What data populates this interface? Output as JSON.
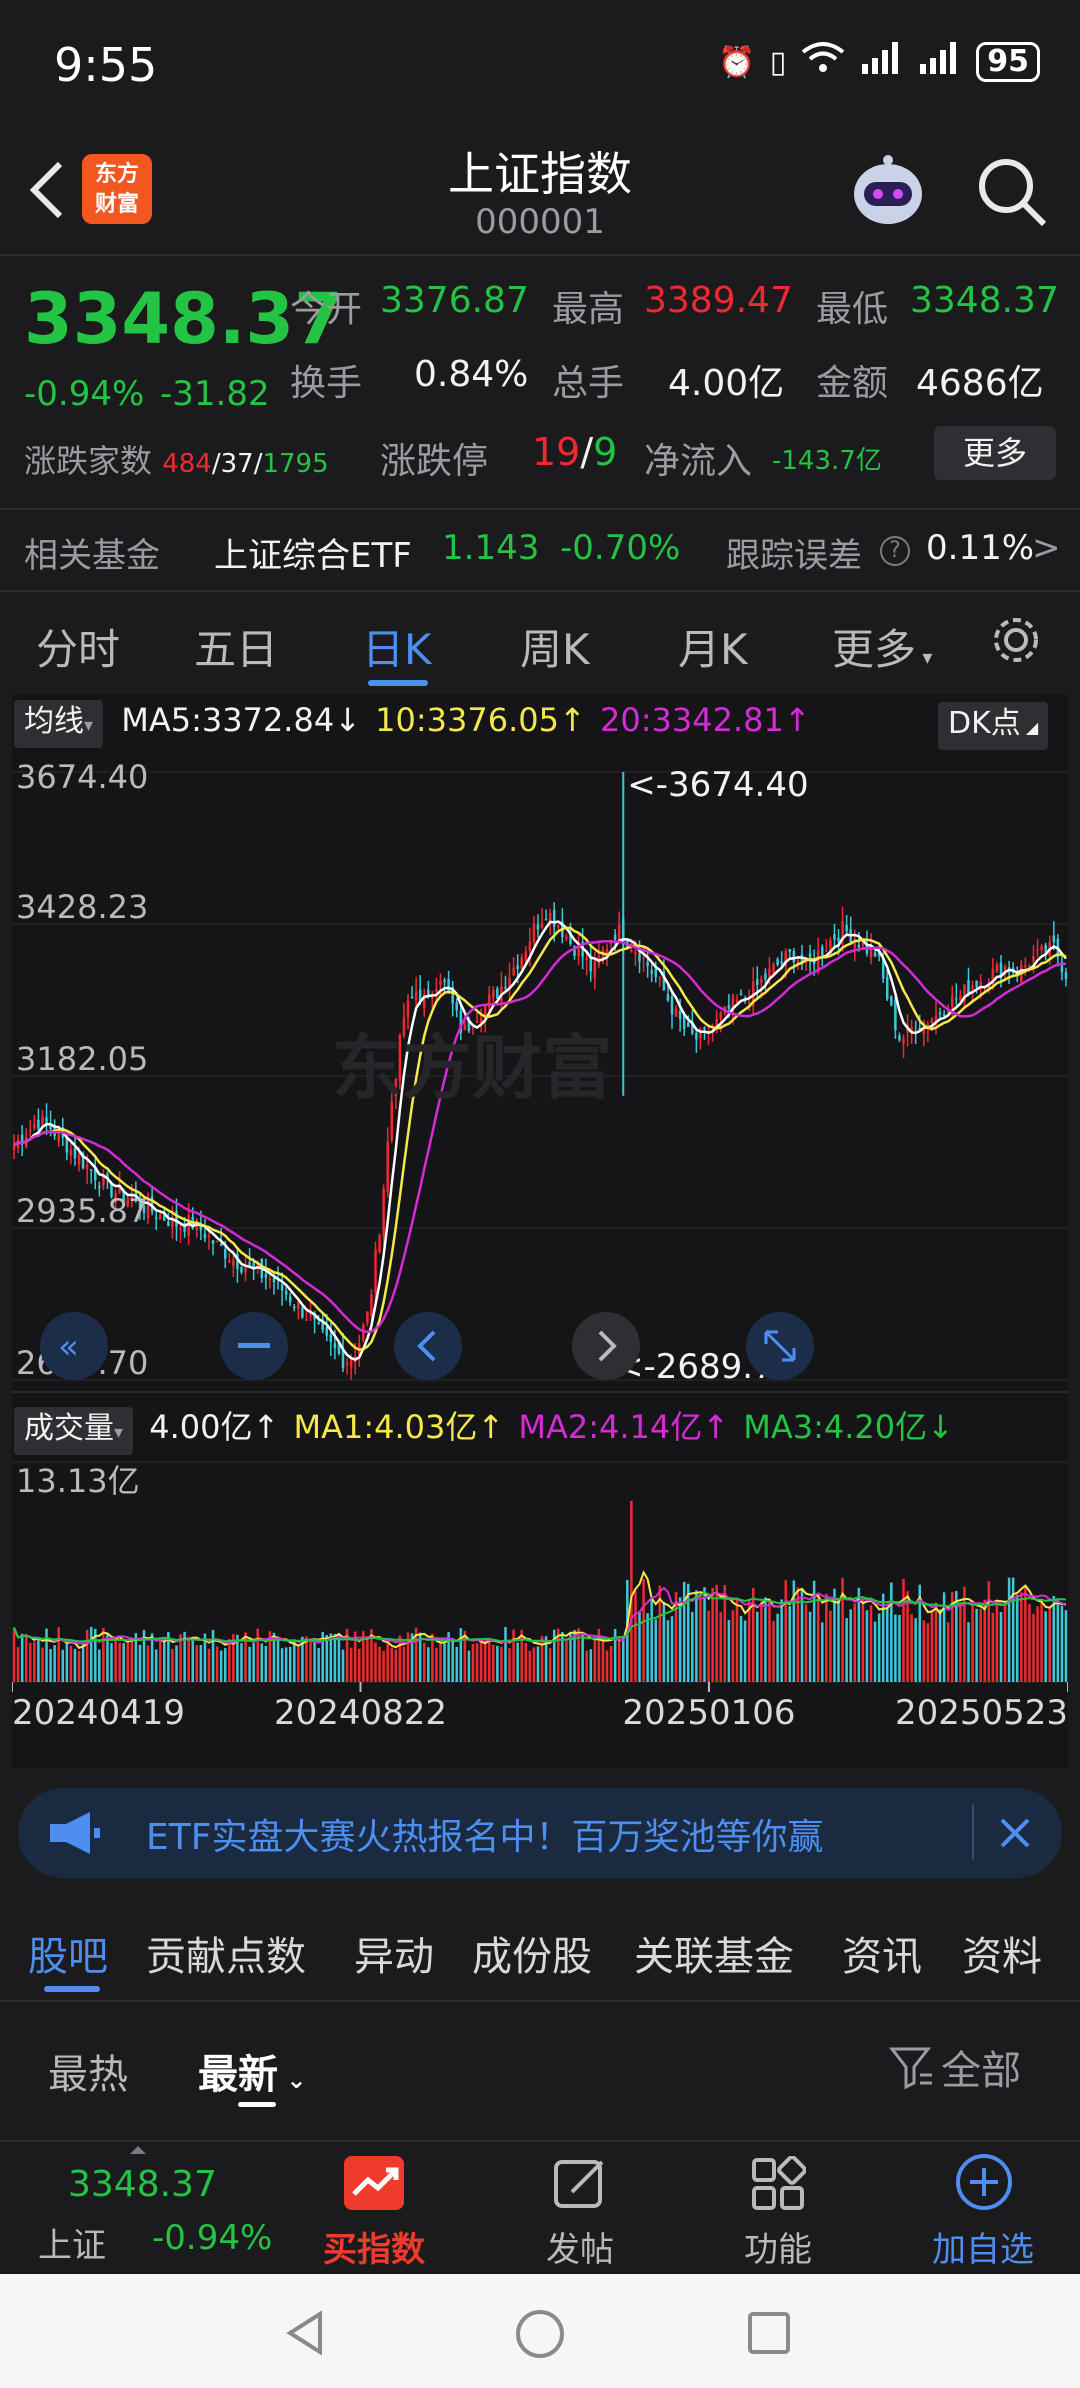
{
  "status_bar": {
    "time": "9:55",
    "battery": "95"
  },
  "header": {
    "title": "上证指数",
    "code": "000001",
    "logo_line1": "东方",
    "logo_line2": "财富"
  },
  "quote": {
    "price": "3348.37",
    "pct_change": "-0.94%",
    "abs_change": "-31.82",
    "open_label": "今开",
    "open": "3376.87",
    "high_label": "最高",
    "high": "3389.47",
    "low_label": "最低",
    "low": "3348.37",
    "turnover_label": "换手",
    "turnover": "0.84%",
    "volume_label": "总手",
    "volume": "4.00亿",
    "amount_label": "金额",
    "amount": "4686亿",
    "breadth_label": "涨跌家数",
    "breadth_up": "484",
    "breadth_flat": "37",
    "breadth_down": "1795",
    "limit_label": "涨跌停",
    "limit_up": "19",
    "limit_down": "9",
    "netflow_label": "净流入",
    "netflow": "-143.7亿",
    "more_button": "更多",
    "sep": "/"
  },
  "fund": {
    "label": "相关基金",
    "name": "上证综合ETF",
    "price": "1.143",
    "change": "-0.70%",
    "tracking_label": "跟踪误差",
    "tracking_value": "0.11%",
    "chevron": ">"
  },
  "period_tabs": [
    "分时",
    "五日",
    "日K",
    "周K",
    "月K",
    "更多"
  ],
  "chart_legend": {
    "ma_button": "均线",
    "ma5": "MA5:3372.84↓",
    "ma10": "10:3376.05↑",
    "ma20": "20:3342.81↑",
    "dk_button": "DK点",
    "vol_button": "成交量",
    "vol": "4.00亿↑",
    "vol_ma1": "MA1:4.03亿↑",
    "vol_ma2": "MA2:4.14亿↑",
    "vol_ma3": "MA3:4.20亿↓"
  },
  "chart_data": {
    "type": "candlestick",
    "title": "",
    "yticks": [
      "3674.40",
      "3428.23",
      "3182.05",
      "2935.87",
      "2689.70"
    ],
    "ylim": [
      2689.7,
      3674.4
    ],
    "high_marker": "<-3674.40",
    "low_marker": "<-2689.70",
    "volume_max_label": "13.13亿",
    "xticks": [
      "20240419",
      "20240822",
      "20250106",
      "20250523"
    ],
    "series": [
      {
        "name": "MA5",
        "color": "#ffffff"
      },
      {
        "name": "MA10",
        "color": "#f5e94a"
      },
      {
        "name": "MA20",
        "color": "#d52bd6"
      }
    ],
    "close_trend": [
      3070,
      3090,
      3110,
      3100,
      3080,
      3060,
      3040,
      3020,
      3000,
      2990,
      2985,
      2970,
      2960,
      2950,
      2940,
      2945,
      2930,
      2910,
      2895,
      2880,
      2870,
      2860,
      2850,
      2830,
      2810,
      2790,
      2760,
      2740,
      2720,
      2740,
      2800,
      2950,
      3150,
      3280,
      3320,
      3300,
      3350,
      3300,
      3250,
      3280,
      3300,
      3320,
      3350,
      3380,
      3420,
      3450,
      3430,
      3400,
      3380,
      3350,
      3390,
      3420,
      3400,
      3380,
      3350,
      3320,
      3280,
      3250,
      3240,
      3260,
      3280,
      3300,
      3310,
      3330,
      3350,
      3370,
      3380,
      3360,
      3380,
      3400,
      3420,
      3410,
      3390,
      3380,
      3300,
      3240,
      3260,
      3270,
      3280,
      3300,
      3310,
      3330,
      3340,
      3350,
      3360,
      3350,
      3370,
      3380,
      3390,
      3348
    ]
  },
  "banner": {
    "text": "ETF实盘大赛火热报名中！百万奖池等你赢"
  },
  "content_tabs": [
    "股吧",
    "贡献点数",
    "异动",
    "成份股",
    "关联基金",
    "资讯",
    "资料"
  ],
  "sort": {
    "hot": "最热",
    "newest": "最新",
    "filter": "全部"
  },
  "bottom_bar": {
    "index_price": "3348.37",
    "index_name": "上证",
    "index_pct": "-0.94%",
    "buy": "买指数",
    "post": "发帖",
    "func": "功能",
    "add": "加自选"
  }
}
